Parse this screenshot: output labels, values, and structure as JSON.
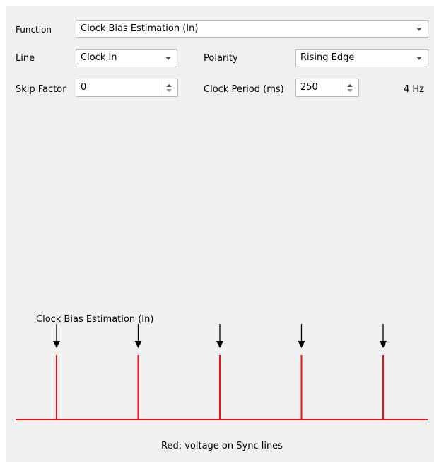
{
  "form": {
    "function_label": "Function",
    "function_value": "Clock Bias Estimation (In)",
    "line_label": "Line",
    "line_value": "Clock In",
    "polarity_label": "Polarity",
    "polarity_value": "Rising Edge",
    "skip_factor_label": "Skip Factor",
    "skip_factor_value": "0",
    "clock_period_label": "Clock Period (ms)",
    "clock_period_value": "250",
    "frequency_text": "4 Hz"
  },
  "diagram": {
    "title": "Clock Bias Estimation (In)",
    "pulse_count": 5,
    "legend": "Red: voltage on Sync lines",
    "line_color": "#ee1111",
    "arrow_color": "#000000"
  }
}
